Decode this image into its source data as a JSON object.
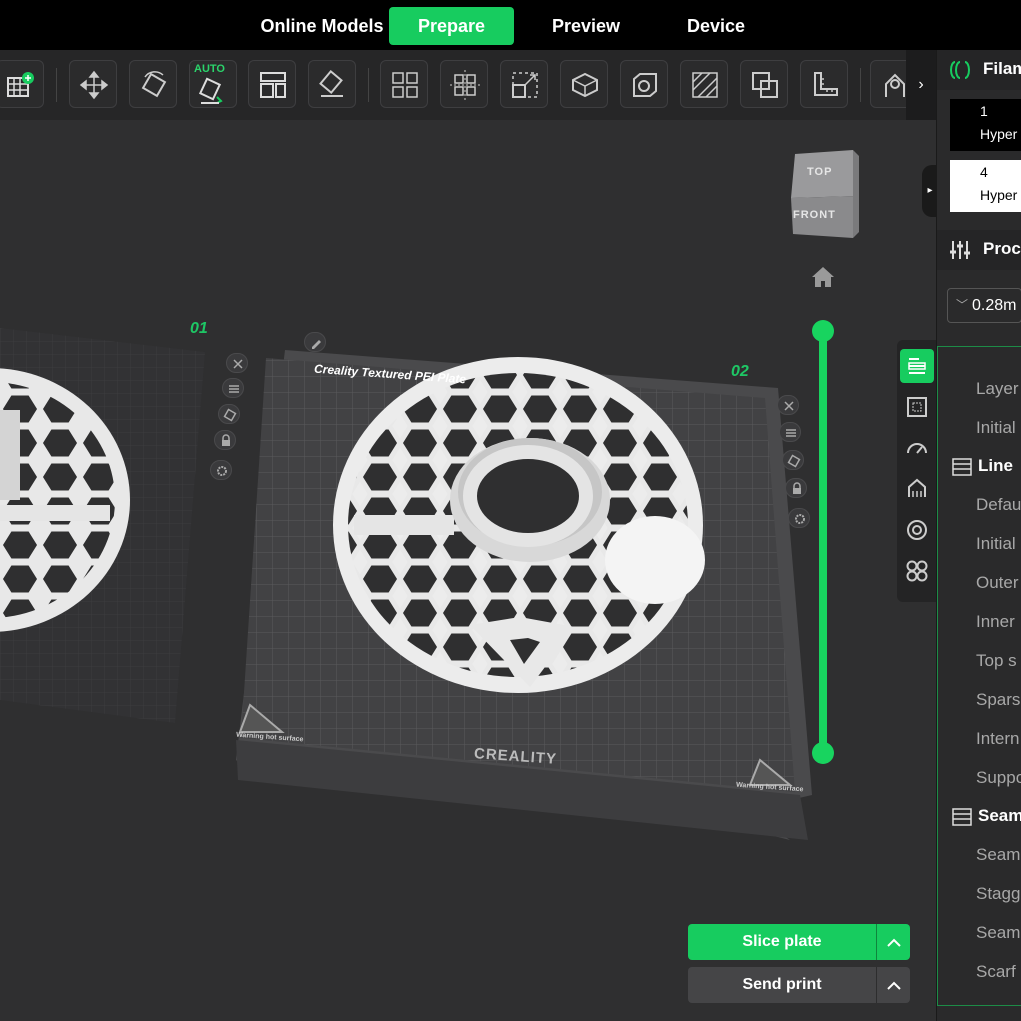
{
  "nav": {
    "tabs": [
      {
        "label": "Online Models"
      },
      {
        "label": "Prepare"
      },
      {
        "label": "Preview"
      },
      {
        "label": "Device"
      }
    ],
    "active": "Prepare"
  },
  "toolbar": {
    "auto_label": "AUTO",
    "tools": [
      "add-plate-icon",
      "move-icon",
      "rotate-icon",
      "auto-orient-icon",
      "arrange-icon",
      "lay-on-face-icon",
      "split-objects-icon",
      "split-parts-icon",
      "scale-icon",
      "cut-icon",
      "hollow-icon",
      "support-paint-icon",
      "seam-paint-icon",
      "boolean-icon",
      "measure-icon",
      "assembly-icon"
    ],
    "expand_glyph": "›"
  },
  "viewport": {
    "plates": [
      {
        "number": "01"
      },
      {
        "number": "02"
      }
    ],
    "plate_name": "Creality Textured PEI Plate",
    "brand": "CREALITY",
    "warning_text": "Warning hot surface",
    "viewcube": {
      "top": "TOP",
      "front": "FRONT"
    }
  },
  "right_panel": {
    "filament_header": "Filam",
    "filaments": [
      {
        "number": "1",
        "name": "Hyper",
        "bg": "#000000",
        "fg": "#ffffff"
      },
      {
        "number": "4",
        "name": "Hyper",
        "bg": "#ffffff",
        "fg": "#000000"
      }
    ],
    "process_header": "Proc",
    "layer_height": "0.28m",
    "items": [
      {
        "kind": "item",
        "label": "Layer"
      },
      {
        "kind": "item",
        "label": "Initial"
      },
      {
        "kind": "header",
        "label": "Line"
      },
      {
        "kind": "item",
        "label": "Defau"
      },
      {
        "kind": "item",
        "label": "Initial"
      },
      {
        "kind": "item",
        "label": "Outer"
      },
      {
        "kind": "item",
        "label": "Inner"
      },
      {
        "kind": "item",
        "label": "Top s"
      },
      {
        "kind": "item",
        "label": "Spars"
      },
      {
        "kind": "item",
        "label": "Intern"
      },
      {
        "kind": "item",
        "label": "Suppo"
      },
      {
        "kind": "header",
        "label": "Seam"
      },
      {
        "kind": "item",
        "label": "Seam"
      },
      {
        "kind": "item",
        "label": "Stagg"
      },
      {
        "kind": "item",
        "label": "Seam"
      },
      {
        "kind": "item",
        "label": "Scarf"
      }
    ]
  },
  "actions": {
    "slice_label": "Slice plate",
    "send_label": "Send print"
  },
  "colors": {
    "accent": "#17cc5f",
    "topbar": "#000000",
    "toolbar": "#262627",
    "viewport": "#2f2f30"
  }
}
